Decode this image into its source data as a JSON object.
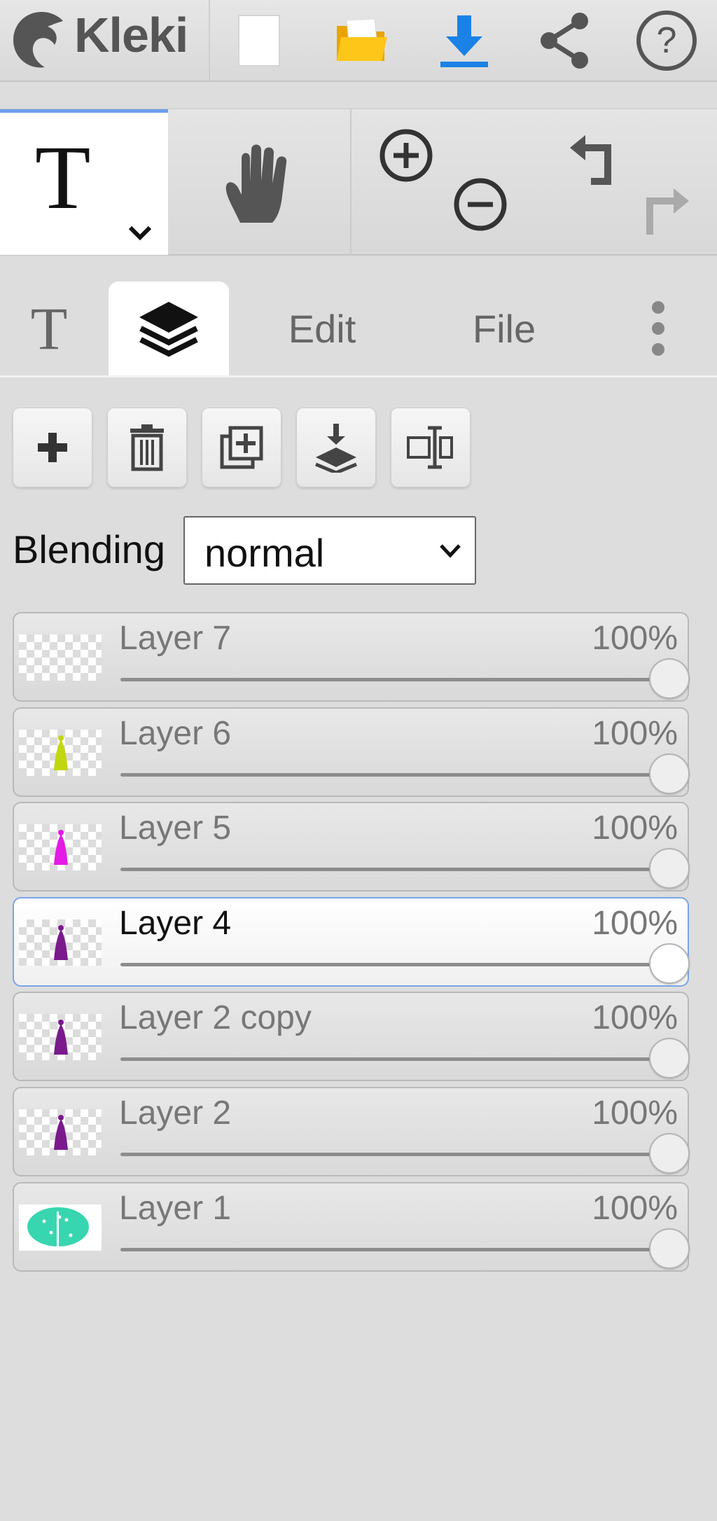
{
  "app": {
    "name": "Kleki"
  },
  "topbar": {
    "new_label": "New image",
    "open_label": "Open",
    "save_label": "Save",
    "share_label": "Share",
    "help_label": "Help"
  },
  "tabs": [
    {
      "id": "tool",
      "label": "T"
    },
    {
      "id": "layers",
      "label": ""
    },
    {
      "id": "edit",
      "label": "Edit"
    },
    {
      "id": "file",
      "label": "File"
    }
  ],
  "blending": {
    "label": "Blending",
    "value": "normal"
  },
  "layers": [
    {
      "name": "Layer 7",
      "opacity_text": "100%",
      "opacity": 1.0,
      "selected": false,
      "thumb_color": ""
    },
    {
      "name": "Layer 6",
      "opacity_text": "100%",
      "opacity": 1.0,
      "selected": false,
      "thumb_color": "#c2d60f"
    },
    {
      "name": "Layer 5",
      "opacity_text": "100%",
      "opacity": 1.0,
      "selected": false,
      "thumb_color": "#e51ae5"
    },
    {
      "name": "Layer 4",
      "opacity_text": "100%",
      "opacity": 1.0,
      "selected": true,
      "thumb_color": "#7a1a8c"
    },
    {
      "name": "Layer 2 copy",
      "opacity_text": "100%",
      "opacity": 1.0,
      "selected": false,
      "thumb_color": "#7a1a8c"
    },
    {
      "name": "Layer 2",
      "opacity_text": "100%",
      "opacity": 1.0,
      "selected": false,
      "thumb_color": "#7a1a8c"
    },
    {
      "name": "Layer 1",
      "opacity_text": "100%",
      "opacity": 1.0,
      "selected": false,
      "thumb_color": "#38d6b0"
    }
  ],
  "colors": {
    "accent": "#6d9eeb",
    "download": "#1a82e6",
    "folder": "#f5b800"
  }
}
